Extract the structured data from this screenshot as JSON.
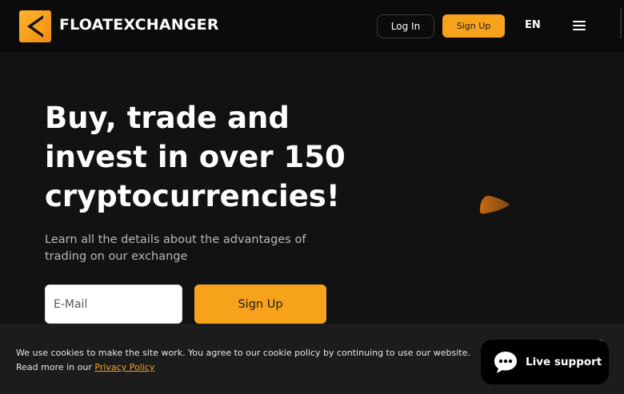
{
  "header": {
    "brand": "FLOATEXCHANGER",
    "login_label": "Log In",
    "signup_label": "Sign Up",
    "language": "EN",
    "menu_icon": "hamburger-menu-icon",
    "logo_icon": "floatexchanger-logo-icon"
  },
  "hero": {
    "title": "Buy, trade and invest in over 150 cryptocurrencies!",
    "subtitle": "Learn all the details about the advantages of trading on our exchange",
    "email_placeholder": "E-Mail",
    "email_value": "",
    "signup_label": "Sign Up",
    "decor_icon": "orange-blob-decoration"
  },
  "cookie": {
    "text_line1": "We use cookies to make the site work. You agree to our cookie policy by continuing to use our website.",
    "read_more": "Read more in our",
    "link_label": "Privacy Policy"
  },
  "support": {
    "label": "Live support",
    "icon": "chat-bubble-icon"
  },
  "colors": {
    "accent": "#f7a21b",
    "background": "#121212",
    "header_bg": "#0b0b0b",
    "cookie_bg": "#1c1c1c"
  }
}
